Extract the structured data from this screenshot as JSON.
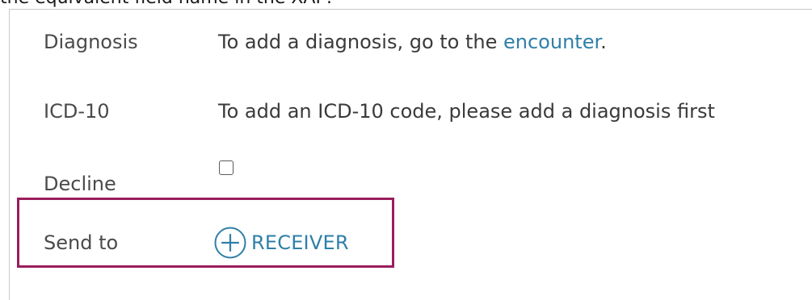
{
  "intro_text": "the equivalent field name in the XAP:",
  "fields": {
    "diagnosis": {
      "label": "Diagnosis",
      "text_before": "To add a diagnosis, go to the ",
      "link": "encounter",
      "text_after": "."
    },
    "icd10": {
      "label": "ICD-10",
      "text": "To add an ICD-10 code, please add a diagnosis first"
    },
    "decline": {
      "label": "Decline",
      "checked": false
    },
    "send_to": {
      "label": "Send to",
      "button_label": "RECEIVER",
      "button_icon": "plus-circle-icon"
    }
  },
  "colors": {
    "link": "#2f7fa8",
    "highlight": "#9a1d5c"
  }
}
